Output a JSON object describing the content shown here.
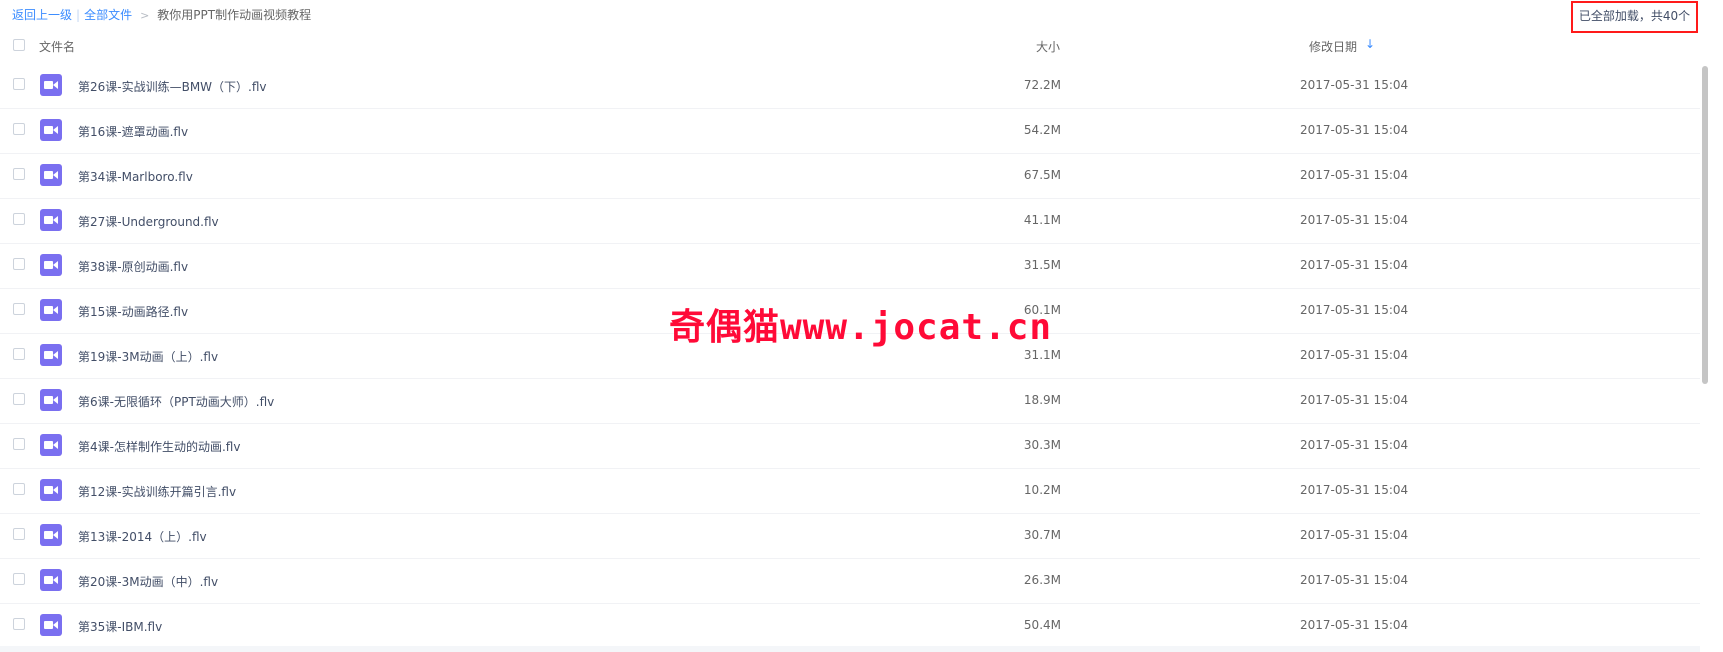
{
  "breadcrumb": {
    "back": "返回上一级",
    "separator": "|",
    "all_files": "全部文件",
    "arrow": ">",
    "current": "教你用PPT制作动画视频教程"
  },
  "load_status": "已全部加载，共40个",
  "header": {
    "name": "文件名",
    "size": "大小",
    "date": "修改日期",
    "sort_icon": "↓"
  },
  "files": [
    {
      "name": "第26课-实战训练—BMW（下）.flv",
      "size": "72.2M",
      "date": "2017-05-31 15:04"
    },
    {
      "name": "第16课-遮罩动画.flv",
      "size": "54.2M",
      "date": "2017-05-31 15:04"
    },
    {
      "name": "第34课-Marlboro.flv",
      "size": "67.5M",
      "date": "2017-05-31 15:04"
    },
    {
      "name": "第27课-Underground.flv",
      "size": "41.1M",
      "date": "2017-05-31 15:04"
    },
    {
      "name": "第38课-原创动画.flv",
      "size": "31.5M",
      "date": "2017-05-31 15:04"
    },
    {
      "name": "第15课-动画路径.flv",
      "size": "60.1M",
      "date": "2017-05-31 15:04"
    },
    {
      "name": "第19课-3M动画（上）.flv",
      "size": "31.1M",
      "date": "2017-05-31 15:04"
    },
    {
      "name": "第6课-无限循环（PPT动画大师）.flv",
      "size": "18.9M",
      "date": "2017-05-31 15:04"
    },
    {
      "name": "第4课-怎样制作生动的动画.flv",
      "size": "30.3M",
      "date": "2017-05-31 15:04"
    },
    {
      "name": "第12课-实战训练开篇引言.flv",
      "size": "10.2M",
      "date": "2017-05-31 15:04"
    },
    {
      "name": "第13课-2014（上）.flv",
      "size": "30.7M",
      "date": "2017-05-31 15:04"
    },
    {
      "name": "第20课-3M动画（中）.flv",
      "size": "26.3M",
      "date": "2017-05-31 15:04"
    },
    {
      "name": "第35课-IBM.flv",
      "size": "50.4M",
      "date": "2017-05-31 15:04"
    }
  ],
  "watermark": "奇偶猫www.jocat.cn",
  "colors": {
    "link": "#3b8cff",
    "file_icon": "#7a6ff0",
    "highlight_border": "#ff1a1a",
    "watermark": "#ff0a37"
  },
  "icons": {
    "file_type": "video-file-icon",
    "sort": "arrow-down-icon"
  }
}
